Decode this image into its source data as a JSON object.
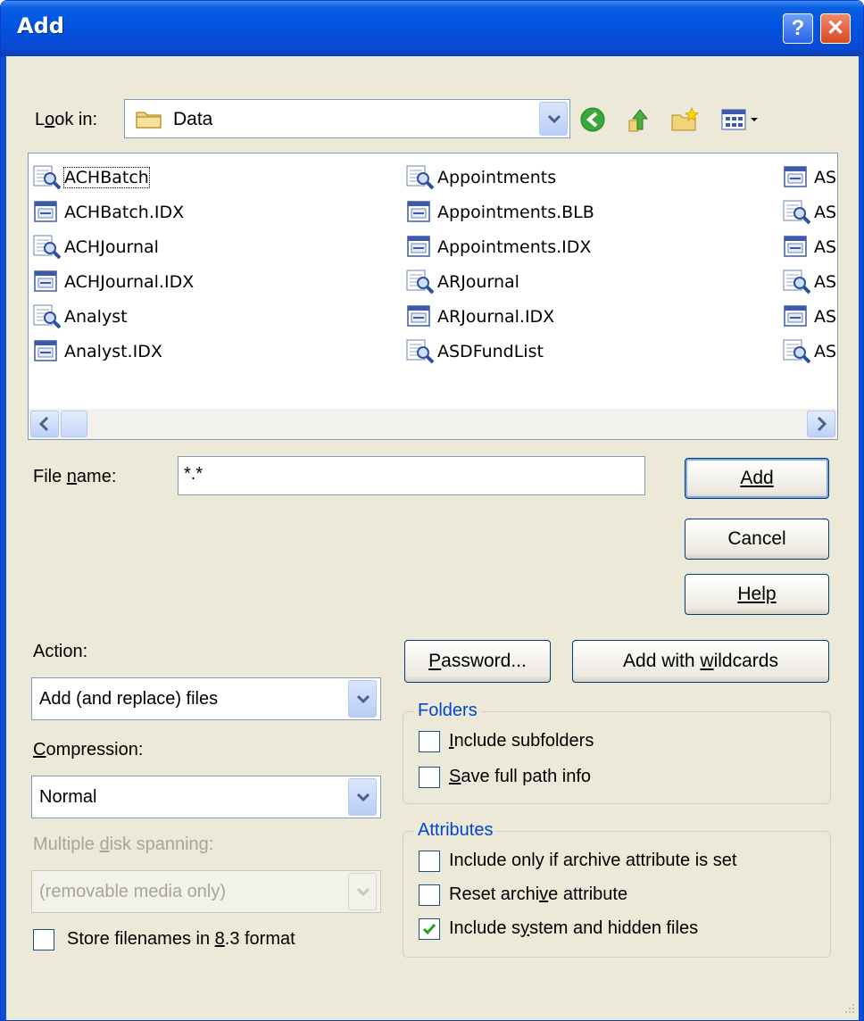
{
  "window": {
    "title": "Add"
  },
  "look_in": {
    "label": "Look in:",
    "value": "Data"
  },
  "files": {
    "columns": [
      [
        "ACHBatch",
        "ACHBatch.IDX",
        "ACHJournal",
        "ACHJournal.IDX",
        "Analyst",
        "Analyst.IDX"
      ],
      [
        "Appointments",
        "Appointments.BLB",
        "Appointments.IDX",
        "ARJournal",
        "ARJournal.IDX",
        "ASDFundList"
      ],
      [
        "ASI",
        "ASI",
        "ASI",
        "ASI",
        "ASI",
        "ASI"
      ]
    ],
    "icon_types": [
      [
        "table",
        "index",
        "table",
        "index",
        "table",
        "index"
      ],
      [
        "table",
        "index",
        "index",
        "table",
        "index",
        "table"
      ],
      [
        "index",
        "table",
        "index",
        "table",
        "index",
        "table"
      ]
    ]
  },
  "file_name": {
    "label": "File name:",
    "value": "*.*"
  },
  "buttons": {
    "add": "Add",
    "cancel": "Cancel",
    "help": "Help",
    "password": "Password...",
    "add_wildcards": "Add with wildcards"
  },
  "action": {
    "label": "Action:",
    "value": "Add (and replace) files"
  },
  "compression": {
    "label": "Compression:",
    "value": "Normal"
  },
  "disk_spanning": {
    "label": "Multiple disk spanning:",
    "value": "(removable media only)"
  },
  "store_83": {
    "label": "Store filenames in 8.3 format",
    "checked": false
  },
  "folders": {
    "title": "Folders",
    "include_subfolders": {
      "label": "Include subfolders",
      "checked": false
    },
    "save_full_path": {
      "label": "Save full path info",
      "checked": false
    }
  },
  "attributes": {
    "title": "Attributes",
    "archive_only": {
      "label": "Include only if archive attribute is set",
      "checked": false
    },
    "reset_archive": {
      "label": "Reset archive attribute",
      "checked": false
    },
    "system_hidden": {
      "label": "Include system and hidden files",
      "checked": true
    }
  },
  "colors": {
    "titlebar": "#0054e3",
    "dialog_bg": "#ECE9D8",
    "group_title": "#0046d5"
  }
}
